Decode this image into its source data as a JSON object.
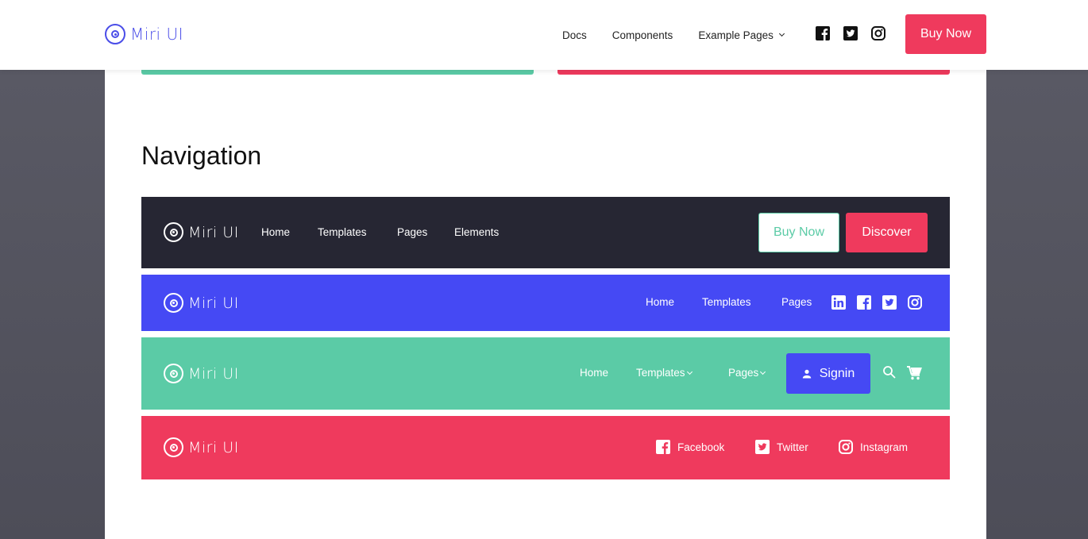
{
  "header": {
    "brand": "Miri UI",
    "nav": [
      {
        "label": "Docs"
      },
      {
        "label": "Components"
      },
      {
        "label": "Example Pages",
        "dropdown": true
      }
    ],
    "socials": [
      "facebook-icon",
      "twitter-icon",
      "instagram-icon"
    ],
    "cta_label": "Buy Now"
  },
  "colors": {
    "primary": "#4549f4",
    "success": "#5bcba6",
    "danger": "#ef3a5d",
    "dark": "#262633"
  },
  "section": {
    "title": "Navigation"
  },
  "navbars": {
    "dark": {
      "brand": "Miri UI",
      "links": [
        "Home",
        "Templates",
        "Pages",
        "Elements"
      ],
      "outline_button": "Buy Now",
      "solid_button": "Discover"
    },
    "primary": {
      "brand": "Miri UI",
      "links": [
        "Home",
        "Templates",
        "Pages"
      ],
      "socials": [
        "linkedin-icon",
        "facebook-icon",
        "twitter-icon",
        "instagram-icon"
      ]
    },
    "success": {
      "brand": "Miri UI",
      "links": [
        {
          "label": "Home",
          "dropdown": false
        },
        {
          "label": "Templates",
          "dropdown": true
        },
        {
          "label": "Pages",
          "dropdown": true
        }
      ],
      "signin_label": "Signin",
      "icons": [
        "search-icon",
        "cart-icon"
      ]
    },
    "danger": {
      "brand": "Miri UI",
      "social_links": [
        {
          "icon": "facebook-icon",
          "label": "Facebook"
        },
        {
          "icon": "twitter-icon",
          "label": "Twitter"
        },
        {
          "icon": "instagram-icon",
          "label": "Instagram"
        }
      ]
    }
  }
}
